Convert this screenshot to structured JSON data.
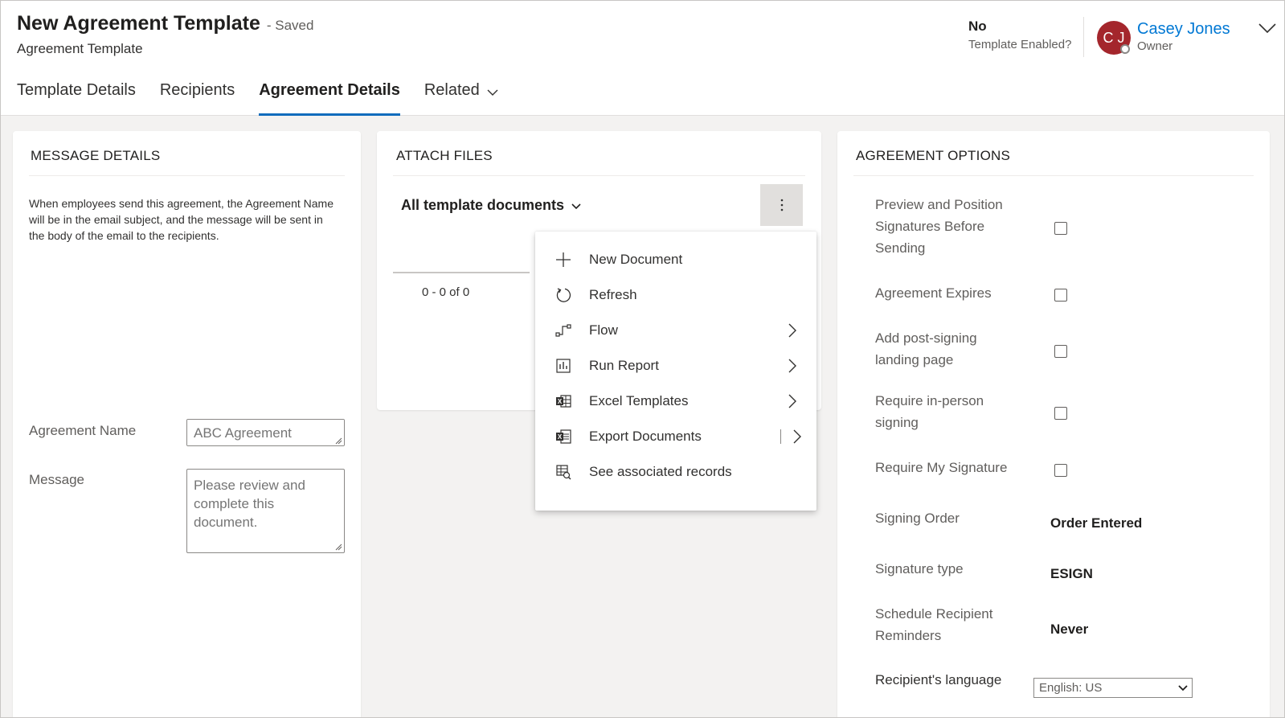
{
  "header": {
    "title": "New Agreement Template",
    "saved_status": "- Saved",
    "entity_name": "Agreement Template",
    "template_enabled_value": "No",
    "template_enabled_label": "Template Enabled?",
    "owner_initials": "C J",
    "owner_name": "Casey Jones",
    "owner_role": "Owner"
  },
  "tabs": [
    {
      "label": "Template Details"
    },
    {
      "label": "Recipients"
    },
    {
      "label": "Agreement Details",
      "active": true
    },
    {
      "label": "Related"
    }
  ],
  "message_details": {
    "title": "MESSAGE DETAILS",
    "description": "When employees send this agreement, the Agreement Name will be in the email subject, and the message will be sent in the body of the email to the recipients.",
    "agreement_name_label": "Agreement Name",
    "agreement_name_placeholder": "ABC Agreement",
    "message_label": "Message",
    "message_placeholder": "Please review and complete this document."
  },
  "attach_files": {
    "title": "ATTACH FILES",
    "view_selector": "All template documents",
    "paging": "0 - 0 of 0"
  },
  "context_menu": {
    "items": [
      {
        "label": "New Document",
        "icon": "plus-icon"
      },
      {
        "label": "Refresh",
        "icon": "refresh-icon"
      },
      {
        "label": "Flow",
        "icon": "flow-icon",
        "submenu": true
      },
      {
        "label": "Run Report",
        "icon": "report-icon",
        "submenu": true
      },
      {
        "label": "Excel Templates",
        "icon": "excel-icon",
        "submenu": true
      },
      {
        "label": "Export Documents",
        "icon": "word-export-icon",
        "submenu": true
      },
      {
        "label": "See associated records",
        "icon": "associated-records-icon"
      }
    ]
  },
  "agreement_options": {
    "title": "AGREEMENT OPTIONS",
    "checkboxes": [
      {
        "label": "Preview and Position Signatures Before Sending",
        "checked": false
      },
      {
        "label": "Agreement Expires",
        "checked": false
      },
      {
        "label": "Add post-signing landing page",
        "checked": false
      },
      {
        "label": "Require in-person signing",
        "checked": false
      },
      {
        "label": "Require My Signature",
        "checked": false
      }
    ],
    "fields": [
      {
        "label": "Signing Order",
        "value": "Order Entered"
      },
      {
        "label": "Signature type",
        "value": "ESIGN"
      },
      {
        "label": "Schedule Recipient Reminders",
        "value": "Never"
      }
    ],
    "language_label": "Recipient's language",
    "language_value": "English: US"
  },
  "colors": {
    "accent": "#0f6cbd",
    "owner_link": "#0078d4",
    "avatar_bg": "#a4262c"
  }
}
